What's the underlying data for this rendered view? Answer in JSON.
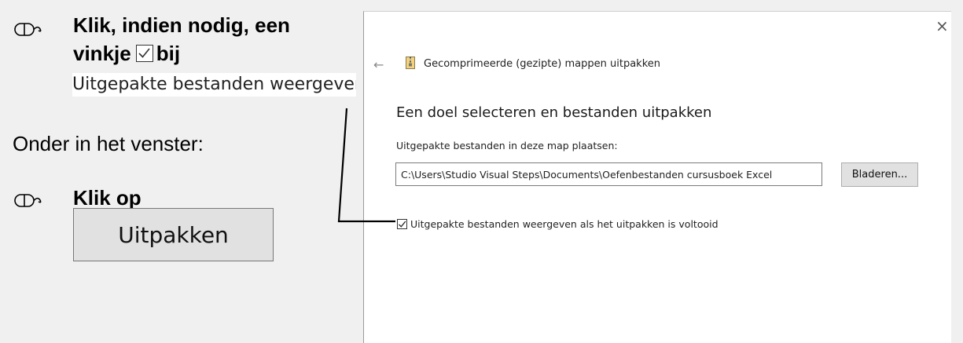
{
  "instructions": {
    "step1_line1": "Klik, indien nodig, een",
    "step1_line2_prefix": "vinkje",
    "step1_line2_suffix": "bij",
    "step1_snippet": "Uitgepakte bestanden weergeven",
    "step2": "Onder in het venster:",
    "step3": "Klik op",
    "step3_button": "Uitpakken"
  },
  "dialog": {
    "close_glyph": "×",
    "back_glyph": "←",
    "wizard_title": "Gecomprimeerde (gezipte) mappen uitpakken",
    "heading": "Een doel selecteren en bestanden uitpakken",
    "field_label": "Uitgepakte bestanden in deze map plaatsen:",
    "path_value": "C:\\Users\\Studio Visual Steps\\Documents\\Oefenbestanden cursusboek Excel",
    "browse_label": "Bladeren...",
    "show_files_label": "Uitgepakte bestanden weergeven als het uitpakken is voltooid",
    "show_files_checked": true
  },
  "icons": {
    "mouse": "mouse-click-icon",
    "zip": "zip-folder-icon",
    "close": "close-icon",
    "back": "back-arrow-icon",
    "check": "checkmark-icon"
  }
}
